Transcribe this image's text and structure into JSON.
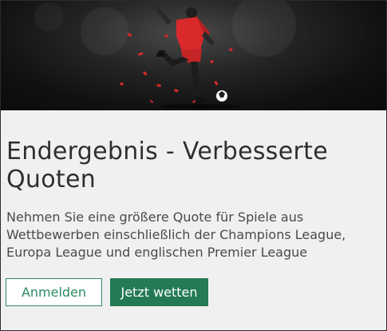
{
  "promo": {
    "hero_image": "football-player-kicking-ball",
    "title": "Endergebnis - Verbesserte Quoten",
    "description": "Nehmen Sie eine größere Quote für Spiele aus Wettbewerben einschließlich der Champions League, Europa League und englischen Premier League"
  },
  "buttons": {
    "login_label": "Anmelden",
    "bet_label": "Jetzt wetten"
  },
  "colors": {
    "accent": "#237a55",
    "background": "#f0f0f0",
    "player_kit": "#d9292b"
  }
}
